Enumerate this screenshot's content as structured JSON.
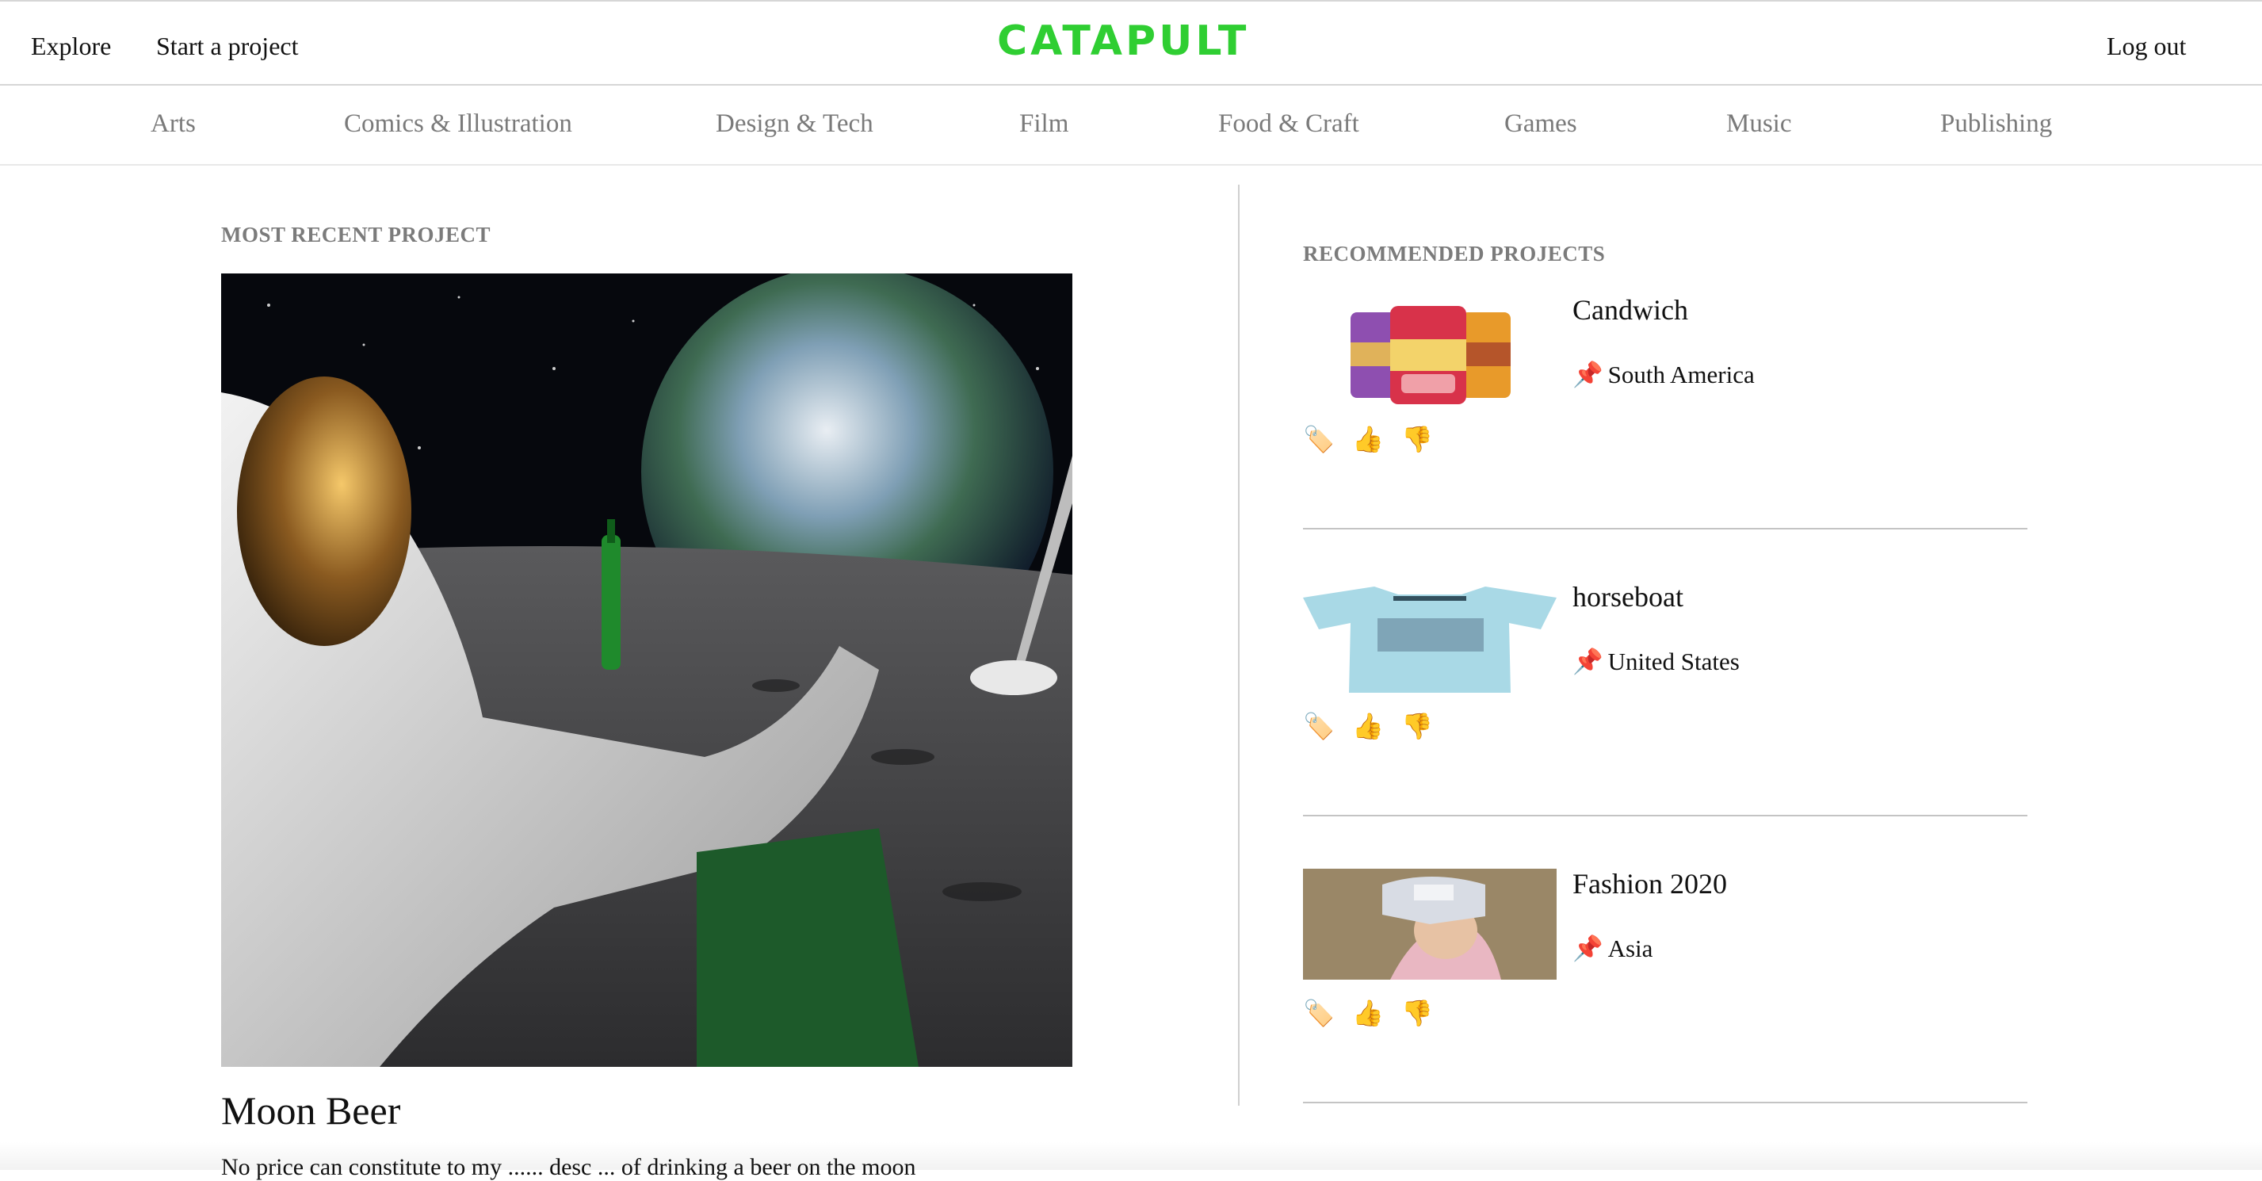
{
  "brand": {
    "logo_text": "CATAPULT",
    "accent_color": "#2fce32"
  },
  "nav": {
    "explore": "Explore",
    "start_project": "Start a project",
    "logout": "Log out"
  },
  "categories": [
    "Arts",
    "Comics & Illustration",
    "Design & Tech",
    "Film",
    "Food & Craft",
    "Games",
    "Music",
    "Publishing"
  ],
  "most_recent": {
    "heading": "MOST RECENT PROJECT",
    "title": "Moon Beer",
    "description": "No price can constitute to my ...... desc ... of drinking a beer on the moon"
  },
  "recommended": {
    "heading": "RECOMMENDED PROJECTS",
    "items": [
      {
        "title": "Candwich",
        "location": "South America"
      },
      {
        "title": "horseboat",
        "location": "United States"
      },
      {
        "title": "Fashion 2020",
        "location": "Asia"
      }
    ]
  },
  "icons": {
    "pin": "📌",
    "tag": "🏷️",
    "like": "👍",
    "dislike": "👎"
  }
}
